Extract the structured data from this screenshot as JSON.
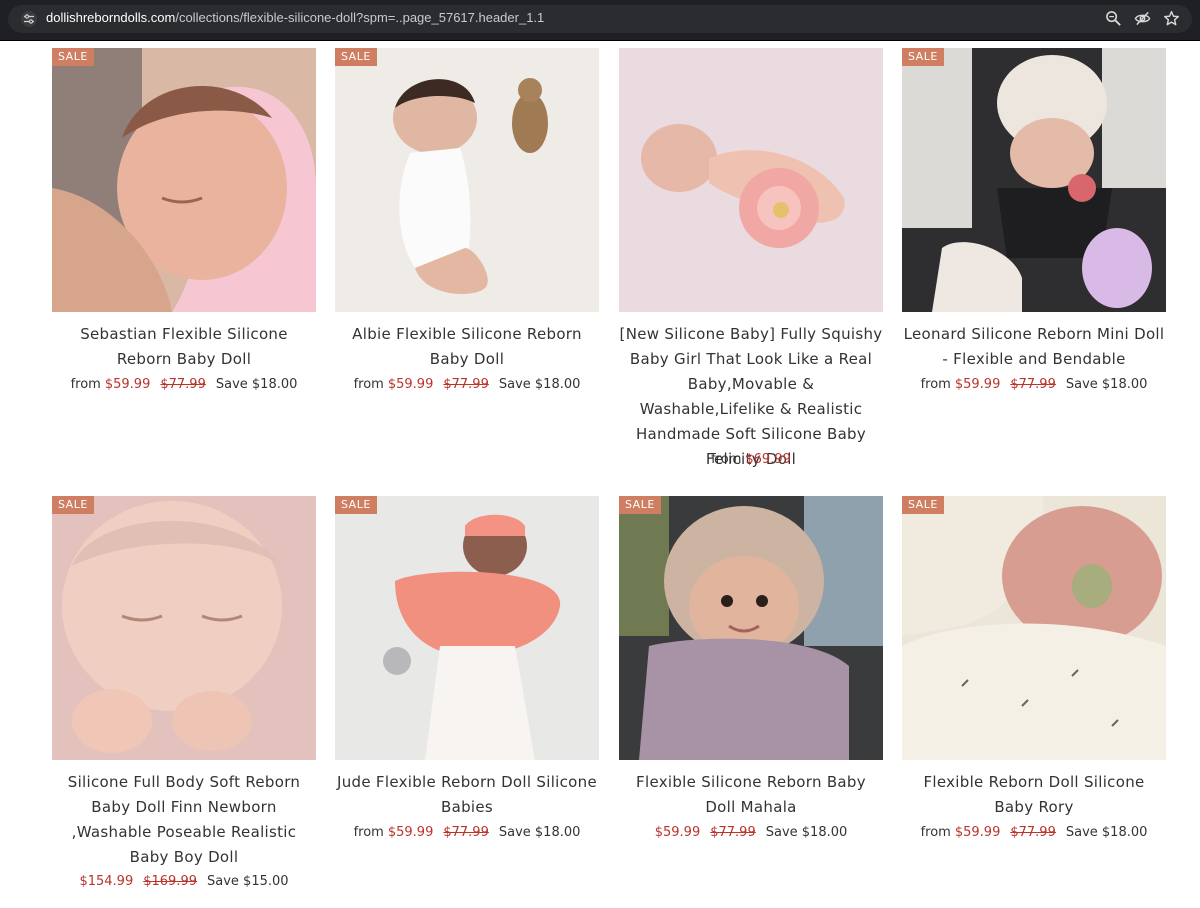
{
  "browser": {
    "url_host": "dollishreborndolls.com",
    "url_path": "/collections/flexible-silicone-doll?spm=..page_57617.header_1.1",
    "icons": [
      "site-info-icon",
      "zoom-icon",
      "eye-slash-icon",
      "star-icon"
    ]
  },
  "colors": {
    "sale_badge": "#cf7e61",
    "price_red": "#b8342c"
  },
  "products": [
    {
      "badge": "SALE",
      "title": "Sebastian Flexible Silicone Reborn Baby Doll",
      "from": "from",
      "price": "$59.99",
      "original": "$77.99",
      "save": "Save $18.00"
    },
    {
      "badge": "SALE",
      "title": "Albie Flexible Silicone Reborn Baby Doll",
      "from": "from",
      "price": "$59.99",
      "original": "$77.99",
      "save": "Save $18.00"
    },
    {
      "badge": "",
      "title": "[New Silicone Baby] Fully Squishy Baby Girl That Look Like a Real Baby,Movable & Washable,Lifelike & Realistic Handmade Soft Silicone Baby Felicity Doll",
      "from": "from",
      "price": "$69.99",
      "original": "",
      "save": ""
    },
    {
      "badge": "SALE",
      "title": "Leonard Silicone Reborn Mini Doll - Flexible and Bendable",
      "from": "from",
      "price": "$59.99",
      "original": "$77.99",
      "save": "Save $18.00"
    },
    {
      "badge": "SALE",
      "title": "Silicone Full Body Soft Reborn Baby Doll Finn Newborn ,Washable Poseable Realistic Baby Boy Doll",
      "from": "",
      "price": "$154.99",
      "original": "$169.99",
      "save": "Save $15.00"
    },
    {
      "badge": "SALE",
      "title": "Jude Flexible Reborn Doll Silicone Babies",
      "from": "from",
      "price": "$59.99",
      "original": "$77.99",
      "save": "Save $18.00"
    },
    {
      "badge": "SALE",
      "title": "Flexible Silicone Reborn Baby Doll Mahala",
      "from": "",
      "price": "$59.99",
      "original": "$77.99",
      "save": "Save $18.00"
    },
    {
      "badge": "SALE",
      "title": "Flexible Reborn Doll Silicone Baby Rory",
      "from": "from",
      "price": "$59.99",
      "original": "$77.99",
      "save": "Save $18.00"
    }
  ]
}
